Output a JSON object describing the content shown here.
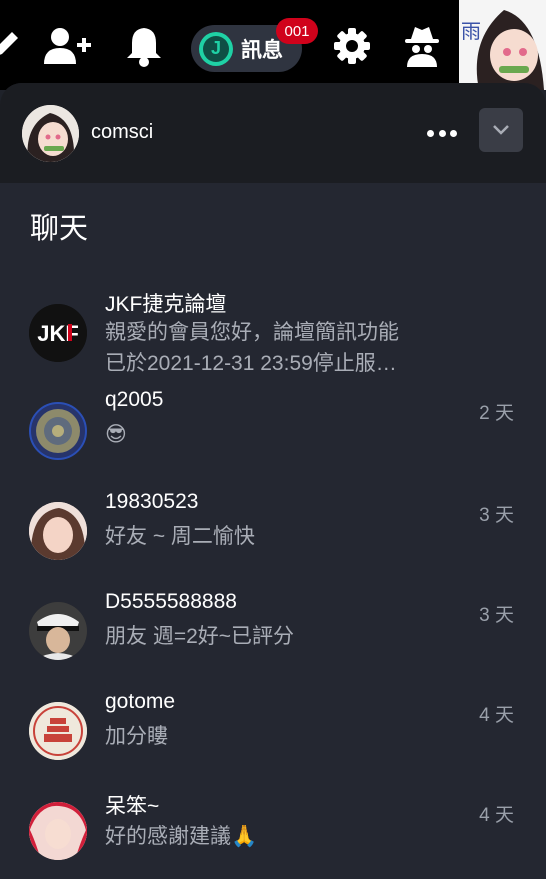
{
  "topnav": {
    "icons": [
      "edit-icon",
      "add-user-icon",
      "bell-icon",
      "gear-icon",
      "incognito-icon"
    ],
    "messages_label": "訊息",
    "messages_badge": "001",
    "logo_letter": "J",
    "corner_text": "雨"
  },
  "panel": {
    "username": "comsci",
    "section_title": "聊天"
  },
  "chats": [
    {
      "name": "JKF捷克論壇",
      "preview_line1": "親愛的會員您好，論壇簡訊功能",
      "preview_line2": "已於2021-12-31 23:59停止服…",
      "time": "",
      "avatar_text": "JKF"
    },
    {
      "name": "q2005",
      "preview_line1": "😎",
      "time": "2 天"
    },
    {
      "name": "19830523",
      "preview_line1": "好友 ~ 周二愉快",
      "time": "3 天"
    },
    {
      "name": "D5555588888",
      "preview_line1": "朋友 週=2好~已評分",
      "time": "3 天"
    },
    {
      "name": "gotome",
      "preview_line1": "加分瞜",
      "time": "4 天"
    },
    {
      "name": "呆笨~",
      "preview_line1": "好的感謝建議🙏",
      "time": "4 天"
    }
  ],
  "colors": {
    "background": "#242731",
    "header": "#1b1d22",
    "badge": "#d0021b",
    "accent": "#1fd1a5"
  }
}
